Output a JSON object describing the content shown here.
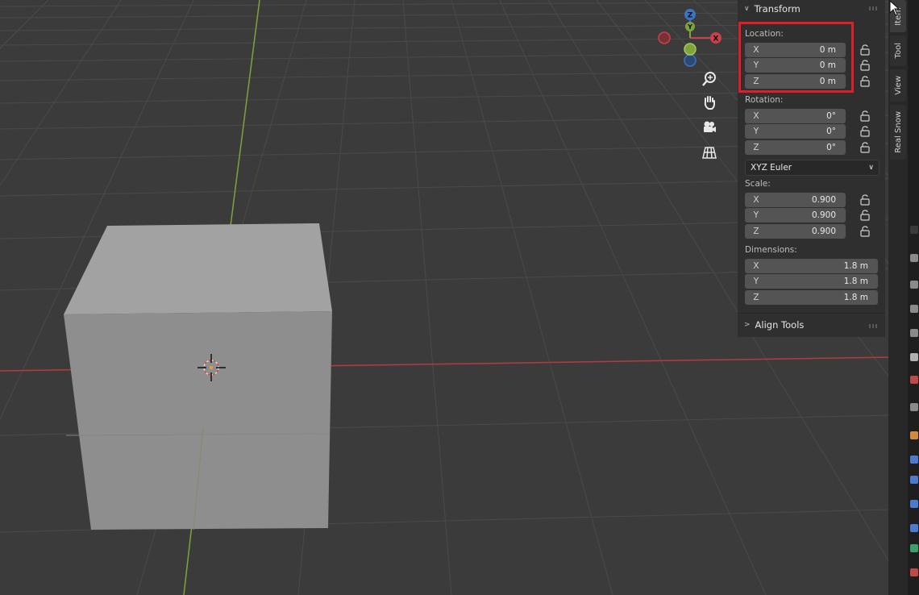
{
  "viewport": {
    "gizmo": {
      "z": "Z",
      "y": "Y",
      "x": "X"
    },
    "colors": {
      "floor": "#3b3b3b",
      "grid": "#4a4a4a",
      "x_axis": "#b43c41",
      "y_axis": "#7ea33c",
      "cube_front": "#8e8e8e",
      "cube_top": "#a2a2a2"
    }
  },
  "panel": {
    "header": "Transform",
    "location": {
      "label": "Location:",
      "x": {
        "axis": "X",
        "value": "0 m"
      },
      "y": {
        "axis": "Y",
        "value": "0 m"
      },
      "z": {
        "axis": "Z",
        "value": "0 m"
      }
    },
    "rotation": {
      "label": "Rotation:",
      "x": {
        "axis": "X",
        "value": "0°"
      },
      "y": {
        "axis": "Y",
        "value": "0°"
      },
      "z": {
        "axis": "Z",
        "value": "0°"
      }
    },
    "rotation_mode": "XYZ Euler",
    "scale": {
      "label": "Scale:",
      "x": {
        "axis": "X",
        "value": "0.900"
      },
      "y": {
        "axis": "Y",
        "value": "0.900"
      },
      "z": {
        "axis": "Z",
        "value": "0.900"
      }
    },
    "dimensions": {
      "label": "Dimensions:",
      "x": {
        "axis": "X",
        "value": "1.8 m"
      },
      "y": {
        "axis": "Y",
        "value": "1.8 m"
      },
      "z": {
        "axis": "Z",
        "value": "1.8 m"
      }
    },
    "align_tools": "Align Tools",
    "highlight_color": "#e11d2a"
  },
  "tabs": {
    "item": "Item",
    "tool": "Tool",
    "view": "View",
    "real_snow": "Real Snow"
  }
}
